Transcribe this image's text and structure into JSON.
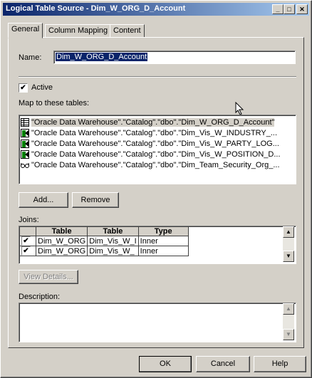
{
  "window": {
    "title": "Logical Table Source - Dim_W_ORG_D_Account",
    "min_glyph": "_",
    "max_glyph": "□",
    "close_glyph": "✕"
  },
  "tabs": [
    {
      "label": "General",
      "active": true
    },
    {
      "label": "Column Mapping",
      "active": false
    },
    {
      "label": "Content",
      "active": false
    }
  ],
  "general": {
    "name_label": "Name:",
    "name_value": "Dim_W_ORG_D_Account",
    "active_label": "Active",
    "active_checked": true,
    "map_label": "Map to these tables:",
    "map_tables": [
      {
        "icon": "table-icon",
        "text": "\"Oracle Data Warehouse\".\"Catalog\".\"dbo\".\"Dim_W_ORG_D_Account\""
      },
      {
        "icon": "join-table-icon",
        "text": "\"Oracle Data Warehouse\".\"Catalog\".\"dbo\".\"Dim_Vis_W_INDUSTRY_..."
      },
      {
        "icon": "join-table-icon",
        "text": "\"Oracle Data Warehouse\".\"Catalog\".\"dbo\".\"Dim_Vis_W_PARTY_LOG..."
      },
      {
        "icon": "join-table-icon",
        "text": "\"Oracle Data Warehouse\".\"Catalog\".\"dbo\".\"Dim_Vis_W_POSITION_D..."
      },
      {
        "icon": "alias-glasses-icon",
        "text": "\"Oracle Data Warehouse\".\"Catalog\".\"dbo\".\"Dim_Team_Security_Org_..."
      }
    ],
    "add_label": "Add...",
    "remove_label": "Remove",
    "joins_label": "Joins:",
    "joins_columns": [
      "Table",
      "Table",
      "Type"
    ],
    "joins_rows": [
      {
        "checked": true,
        "left": "Dim_W_ORG",
        "right": "Dim_Vis_W_I",
        "type": "Inner"
      },
      {
        "checked": true,
        "left": "Dim_W_ORG",
        "right": "Dim_Vis_W_",
        "type": "Inner"
      }
    ],
    "view_details_label": "View Details...",
    "description_label": "Description:",
    "description_value": ""
  },
  "footer": {
    "ok_label": "OK",
    "cancel_label": "Cancel",
    "help_label": "Help"
  }
}
